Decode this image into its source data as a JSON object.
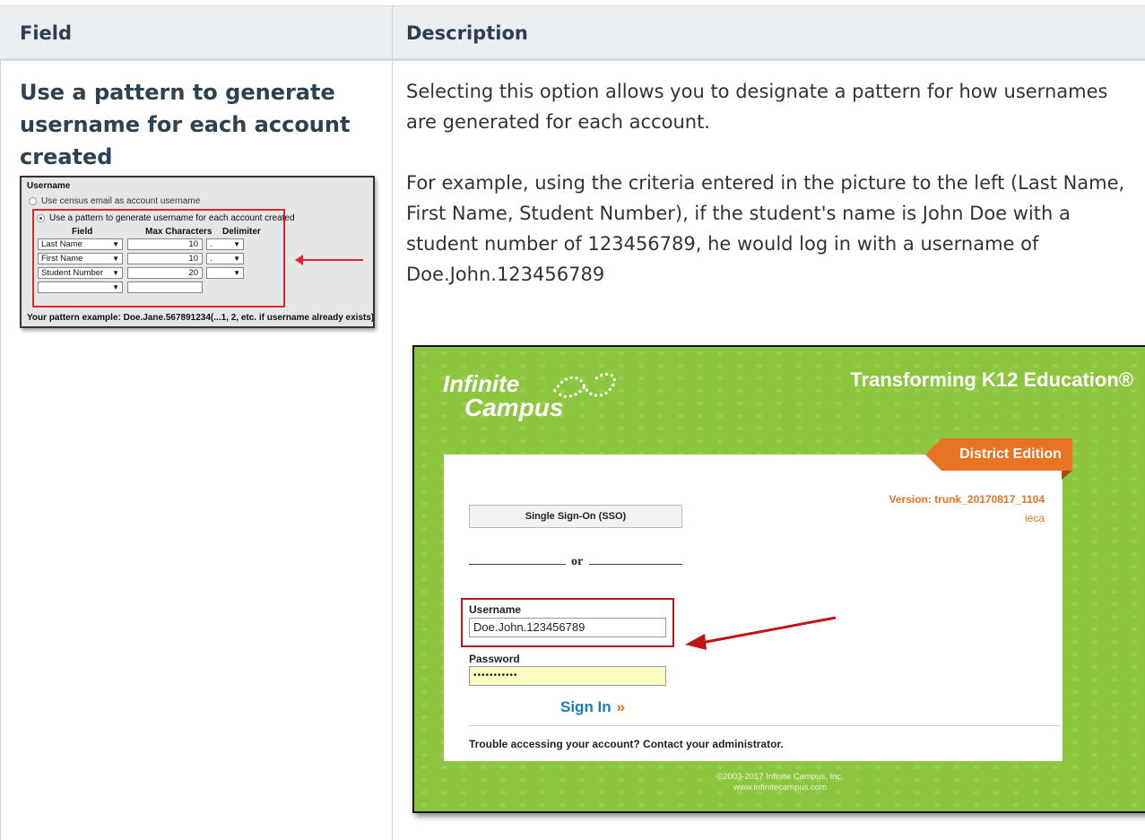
{
  "table": {
    "headers": {
      "field": "Field",
      "description": "Description"
    },
    "row": {
      "field_title": "Use a pattern to generate username for each account created",
      "description_p1": "Selecting this option allows you to designate a pattern for how usernames are generated for each account.",
      "description_p2": "For example, using the criteria entered in the picture to the left (Last Name, First Name, Student Number), if the student's name is John Doe with a student number of 123456789, he would log in with a username of Doe.John.123456789"
    }
  },
  "pattern_screenshot": {
    "section_label": "Username",
    "option_census": "Use census email as account username",
    "option_pattern": "Use a pattern to generate username for each account created",
    "columns": {
      "field": "Field",
      "max_chars": "Max Characters",
      "delimiter": "Delimiter"
    },
    "rows": [
      {
        "field": "Last Name",
        "max": "10",
        "delim": "."
      },
      {
        "field": "First Name",
        "max": "10",
        "delim": "."
      },
      {
        "field": "Student Number",
        "max": "20",
        "delim": ""
      },
      {
        "field": "",
        "max": "",
        "delim": null
      }
    ],
    "example": "Your pattern example: Doe.Jane.567891234(...1, 2, etc. if username already exists)"
  },
  "login_screenshot": {
    "logo_line1": "Infinite",
    "logo_line2": "Campus",
    "tagline": "Transforming K12 Education®",
    "edition": "District Edition",
    "version": "Version: trunk_20170817_1104",
    "app_name": "ieca",
    "sso_button": "Single Sign-On (SSO)",
    "or_text": "or",
    "username_label": "Username",
    "username_value": "Doe.John.123456789",
    "password_label": "Password",
    "password_value": "•••••••••••",
    "signin_label": "Sign In",
    "signin_icon": "double-chevron-right-icon",
    "trouble_text": "Trouble accessing your account? Contact your administrator.",
    "copyright_line1": "©2003-2017 Infinite Campus, Inc.",
    "copyright_line2": "www.infinitecampus.com"
  },
  "colors": {
    "header_bg": "#eceff1",
    "title_color": "#2c4152",
    "login_green": "#8cc63f",
    "accent_orange": "#e87322",
    "highlight_red": "#b8161c",
    "link_blue": "#1d7ac2",
    "password_bg": "#fbfcc4"
  }
}
